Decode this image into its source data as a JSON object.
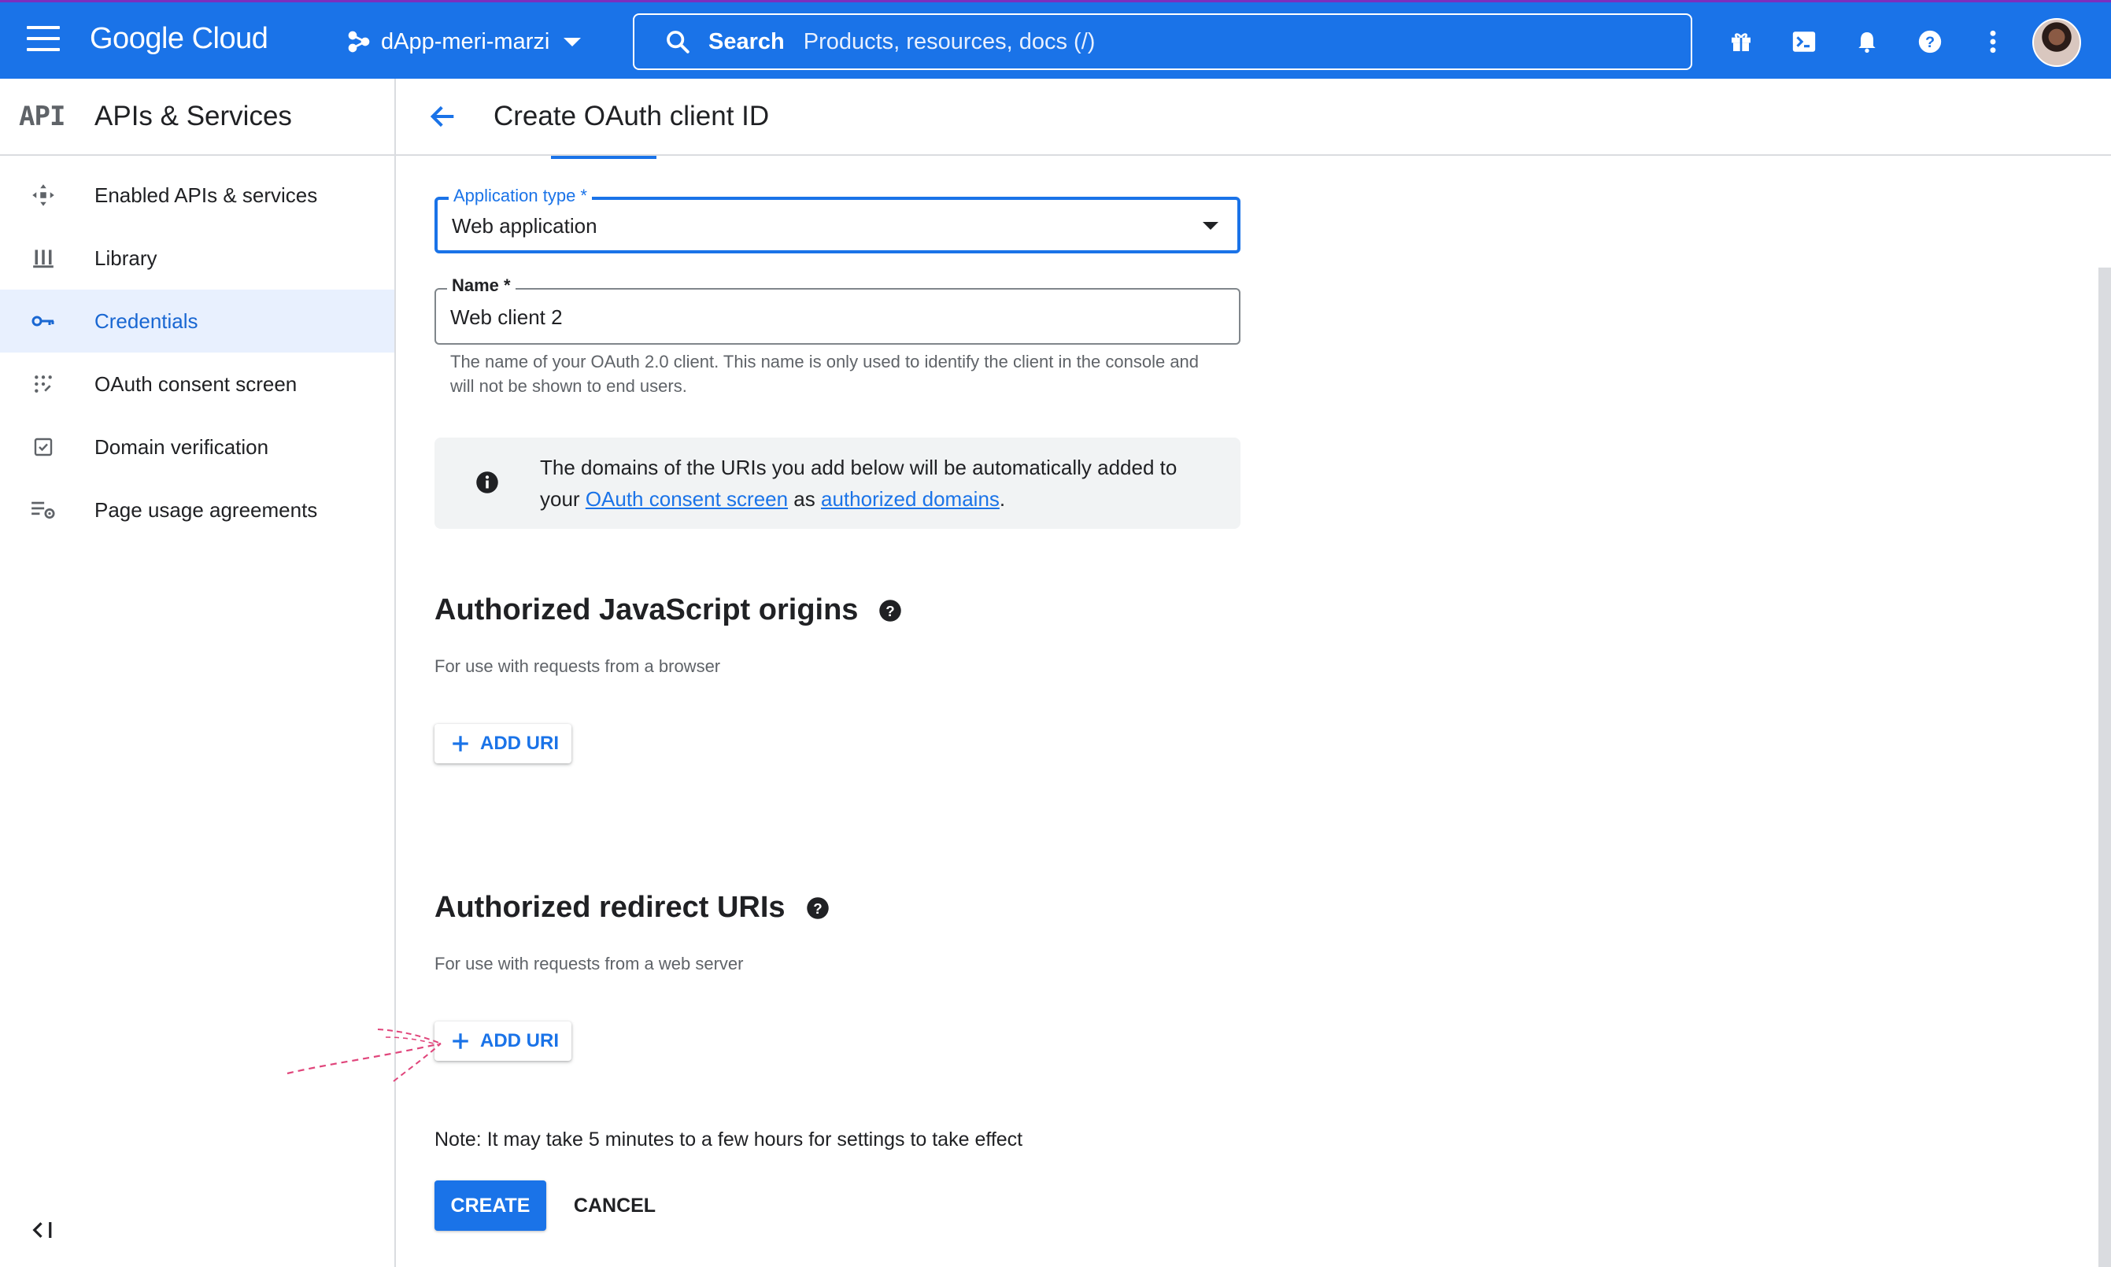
{
  "topbar": {
    "brand": "Google Cloud",
    "project": "dApp-meri-marzi",
    "search_label": "Search",
    "search_placeholder": "Products, resources, docs (/)",
    "icons": [
      "gift-icon",
      "cloud-shell-icon",
      "notifications-bell-icon",
      "help-icon",
      "more-vert-icon"
    ]
  },
  "sidebar": {
    "logo": "API",
    "title": "APIs & Services",
    "items": [
      {
        "label": "Enabled APIs & services",
        "icon": "enabled-apis-icon"
      },
      {
        "label": "Library",
        "icon": "library-icon"
      },
      {
        "label": "Credentials",
        "icon": "key-icon",
        "active": true
      },
      {
        "label": "OAuth consent screen",
        "icon": "consent-grid-icon"
      },
      {
        "label": "Domain verification",
        "icon": "checkbox-icon"
      },
      {
        "label": "Page usage agreements",
        "icon": "settings-list-icon"
      }
    ]
  },
  "header": {
    "title": "Create OAuth client ID"
  },
  "form": {
    "app_type": {
      "label": "Application type *",
      "value": "Web application"
    },
    "name": {
      "label": "Name *",
      "value": "Web client 2",
      "helper": "The name of your OAuth 2.0 client. This name is only used to identify the client in the console and will not be shown to end users."
    },
    "info": {
      "text_before": "The domains of the URIs you add below will be automatically added to your ",
      "link1": "OAuth consent screen",
      "text_middle": " as ",
      "link2": "authorized domains",
      "text_after": "."
    },
    "js_origins": {
      "title": "Authorized JavaScript origins",
      "subtitle": "For use with requests from a browser",
      "button": "ADD URI"
    },
    "redirect_uris": {
      "title": "Authorized redirect URIs",
      "subtitle": "For use with requests from a web server",
      "button": "ADD URI"
    },
    "note": "Note: It may take 5 minutes to a few hours for settings to take effect",
    "create_label": "CREATE",
    "cancel_label": "CANCEL"
  },
  "colors": {
    "accent": "#1a73e8",
    "active_bg": "#e8f0fe",
    "annotation": "#e0457b"
  }
}
